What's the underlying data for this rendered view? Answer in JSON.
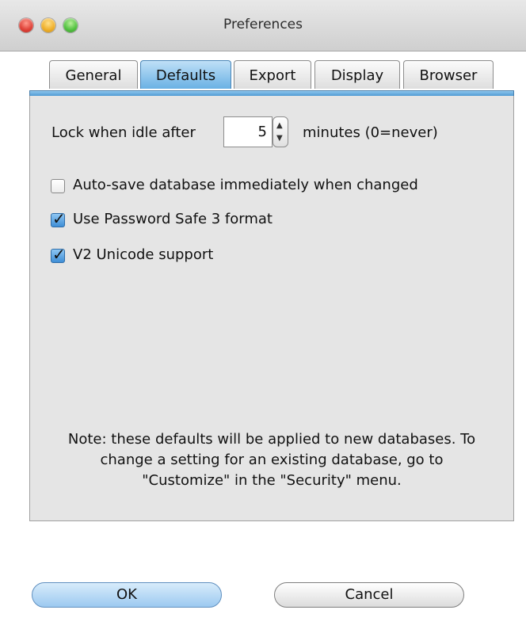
{
  "window": {
    "title": "Preferences"
  },
  "tabs": [
    {
      "label": "General"
    },
    {
      "label": "Defaults"
    },
    {
      "label": "Export"
    },
    {
      "label": "Display"
    },
    {
      "label": "Browser"
    }
  ],
  "defaults": {
    "lock_label": "Lock when idle after",
    "lock_value": "5",
    "lock_suffix": "minutes (0=never)",
    "options": [
      {
        "label": "Auto-save database immediately when changed",
        "checked": false
      },
      {
        "label": "Use Password Safe 3 format",
        "checked": true
      },
      {
        "label": "V2 Unicode support",
        "checked": true
      }
    ],
    "note": "Note: these defaults will be applied to new databases. To change a setting for an existing database, go to \"Customize\" in the \"Security\" menu."
  },
  "buttons": {
    "ok": "OK",
    "cancel": "Cancel"
  }
}
